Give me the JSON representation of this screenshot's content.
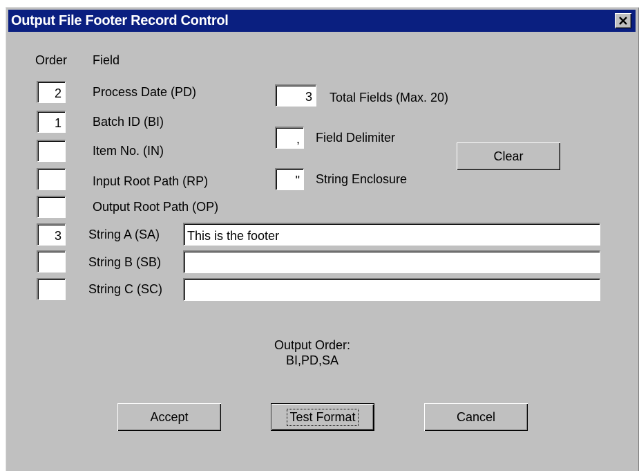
{
  "window": {
    "title": "Output File Footer Record Control",
    "close_glyph": "✕"
  },
  "headers": {
    "order": "Order",
    "field": "Field"
  },
  "fields": [
    {
      "order": "2",
      "label": "Process Date (PD)"
    },
    {
      "order": "1",
      "label": "Batch ID (BI)"
    },
    {
      "order": "",
      "label": "Item No. (IN)"
    },
    {
      "order": "",
      "label": "Input Root Path (RP)"
    },
    {
      "order": "",
      "label": "Output Root Path (OP)"
    }
  ],
  "strings": [
    {
      "order": "3",
      "label": "String A (SA)",
      "value": "This is the footer"
    },
    {
      "order": "",
      "label": "String B (SB)",
      "value": ""
    },
    {
      "order": "",
      "label": "String C (SC)",
      "value": ""
    }
  ],
  "settings": {
    "total_fields_value": "3",
    "total_fields_label": "Total Fields (Max. 20)",
    "delimiter_value": ",",
    "delimiter_label": "Field Delimiter",
    "enclosure_value": "\"",
    "enclosure_label": "String Enclosure"
  },
  "output": {
    "label": "Output Order:",
    "value": "BI,PD,SA"
  },
  "buttons": {
    "clear": "Clear",
    "accept": "Accept",
    "test_format": "Test Format",
    "cancel": "Cancel"
  }
}
